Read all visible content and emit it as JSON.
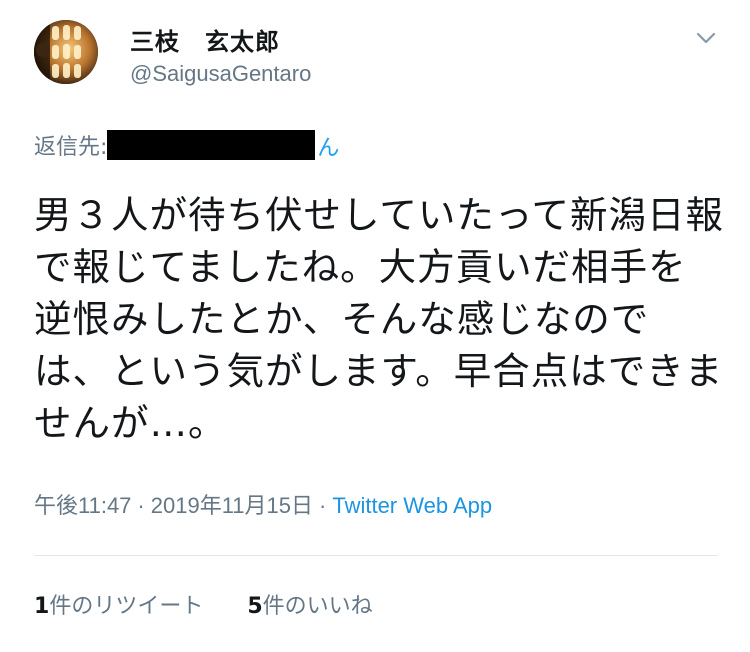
{
  "user": {
    "display_name": "三枝　玄太郎",
    "handle": "@SaigusaGentaro"
  },
  "reply": {
    "label": "返信先:",
    "tail": "ん"
  },
  "tweet": {
    "text": "男３人が待ち伏せしていたって新潟日報で報じてましたね。大方貢いだ相手を逆恨みしたとか、そんな感じなのでは、という気がします。早合点はできませんが…。"
  },
  "meta": {
    "time": "午後11:47",
    "separator": "·",
    "date": "2019年11月15日",
    "app": "Twitter Web App"
  },
  "stats": {
    "retweets_count": "1",
    "retweets_label": "件のリツイート",
    "likes_count": "5",
    "likes_label": "件のいいね"
  },
  "icons": {
    "avatar": "avatar-photo",
    "caret": "chevron-down-icon"
  },
  "colors": {
    "text": "#14171a",
    "secondary": "#657786",
    "link": "#1b95e0",
    "divider": "#e1e8ed"
  }
}
